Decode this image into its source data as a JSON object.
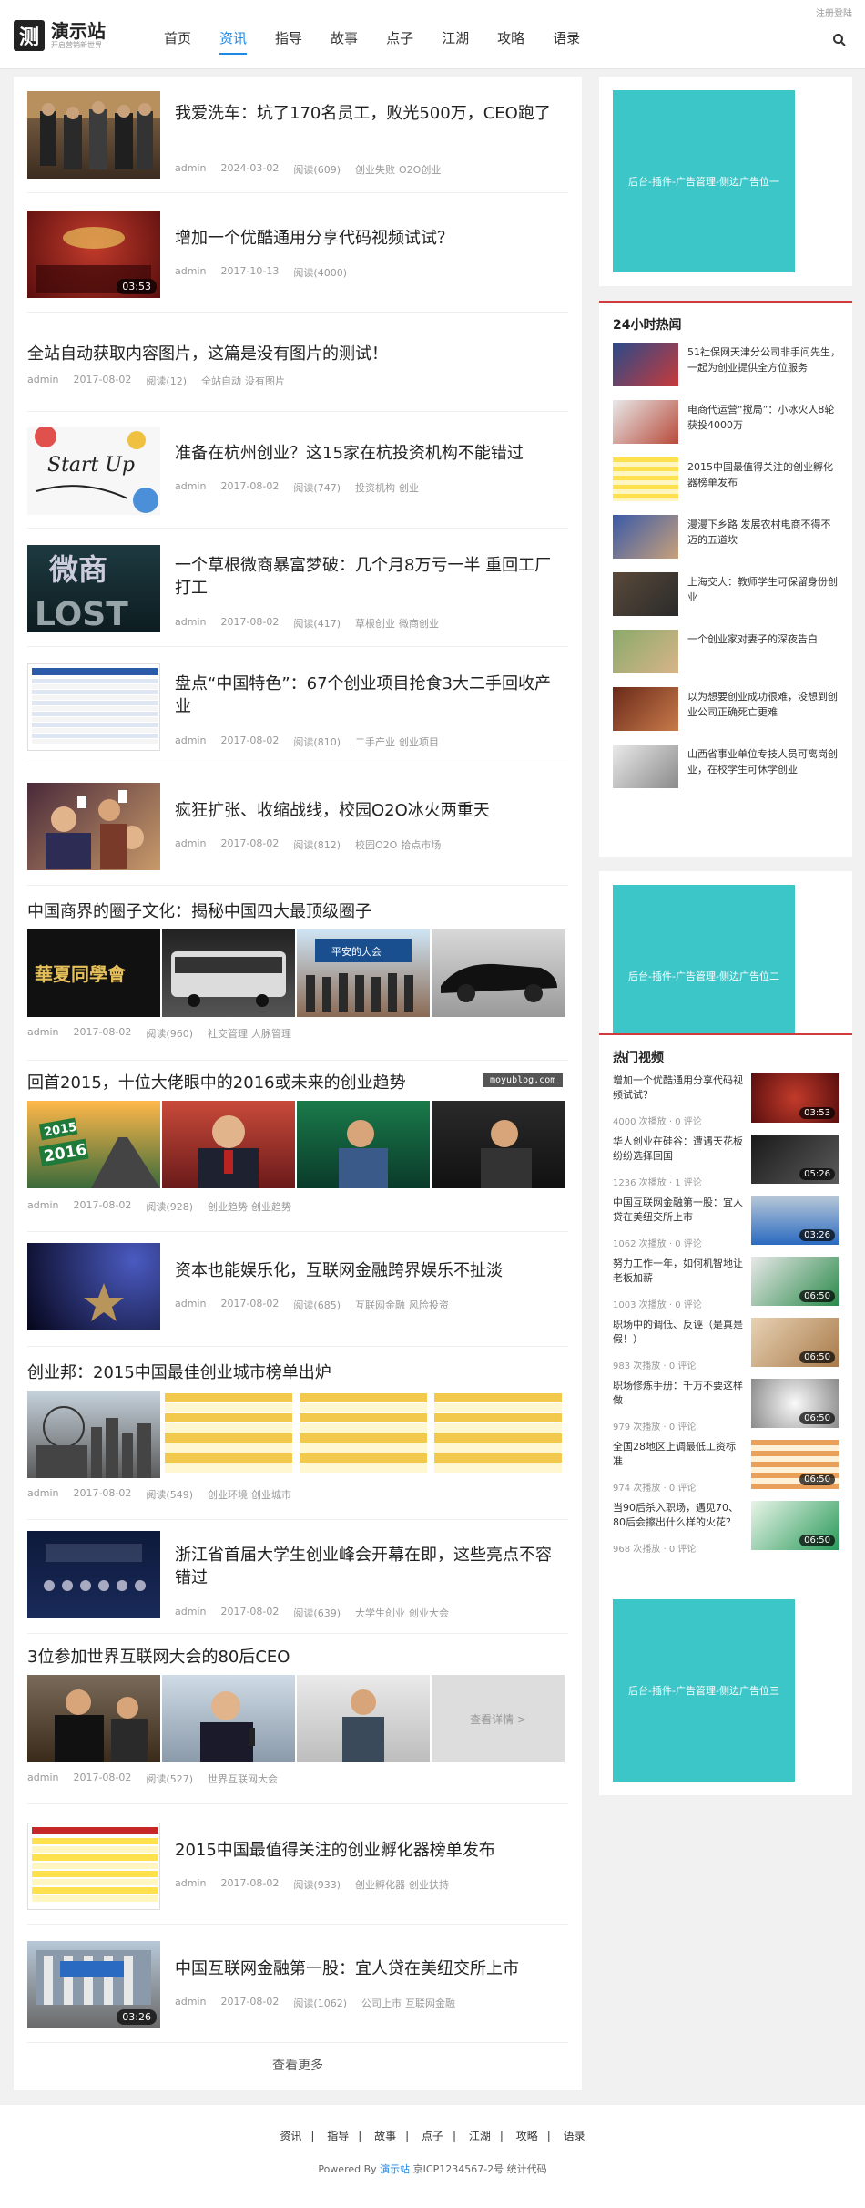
{
  "header": {
    "toplink": "注册登陆",
    "logo_char": "测",
    "logo_name": "演示站",
    "logo_sub": "开启营销新世界",
    "nav": [
      "首页",
      "资讯",
      "指导",
      "故事",
      "点子",
      "江湖",
      "攻略",
      "语录"
    ],
    "active": "资讯"
  },
  "posts": [
    {
      "title": "我爱洗车：坑了170名员工，败光500万，CEO跑了",
      "author": "admin",
      "date": "2024-03-02",
      "views": "阅读(609)",
      "tags": [
        "创业失败",
        "O2O创业"
      ]
    },
    {
      "title": "增加一个优酷通用分享代码视频试试？",
      "author": "admin",
      "date": "2017-10-13",
      "views": "阅读(4000)",
      "tags": [],
      "duration": "03:53"
    },
    {
      "title": "全站自动获取内容图片，这篇是没有图片的测试！",
      "author": "admin",
      "date": "2017-08-02",
      "views": "阅读(12)",
      "tags": [
        "全站自动",
        "没有图片"
      ]
    },
    {
      "title": "准备在杭州创业？这15家在杭投资机构不能错过",
      "author": "admin",
      "date": "2017-08-02",
      "views": "阅读(747)",
      "tags": [
        "投资机构",
        "创业"
      ]
    },
    {
      "title": "一个草根微商暴富梦破：几个月8万亏一半 重回工厂打工",
      "author": "admin",
      "date": "2017-08-02",
      "views": "阅读(417)",
      "tags": [
        "草根创业",
        "微商创业"
      ]
    },
    {
      "title": "盘点“中国特色”：67个创业项目抢食3大二手回收产业",
      "author": "admin",
      "date": "2017-08-02",
      "views": "阅读(810)",
      "tags": [
        "二手产业",
        "创业项目"
      ]
    },
    {
      "title": "疯狂扩张、收缩战线，校园O2O冰火两重天",
      "author": "admin",
      "date": "2017-08-02",
      "views": "阅读(812)",
      "tags": [
        "校园O2O",
        "拾点市场"
      ]
    },
    {
      "title": "中国商界的圈子文化：揭秘中国四大最顶级圈子",
      "author": "admin",
      "date": "2017-08-02",
      "views": "阅读(960)",
      "tags": [
        "社交管理",
        "人脉管理"
      ]
    },
    {
      "title": "回首2015，十位大佬眼中的2016或未来的创业趋势",
      "author": "admin",
      "date": "2017-08-02",
      "views": "阅读(928)",
      "tags": [
        "创业趋势",
        "创业趋势"
      ]
    },
    {
      "title": "资本也能娱乐化，互联网金融跨界娱乐不扯淡",
      "author": "admin",
      "date": "2017-08-02",
      "views": "阅读(685)",
      "tags": [
        "互联网金融",
        "风险投资"
      ]
    },
    {
      "title": "创业邦：2015中国最佳创业城市榜单出炉",
      "author": "admin",
      "date": "2017-08-02",
      "views": "阅读(549)",
      "tags": [
        "创业环境",
        "创业城市"
      ]
    },
    {
      "title": "浙江省首届大学生创业峰会开幕在即，这些亮点不容错过",
      "author": "admin",
      "date": "2017-08-02",
      "views": "阅读(639)",
      "tags": [
        "大学生创业",
        "创业大会"
      ]
    },
    {
      "title": "3位参加世界互联网大会的80后CEO",
      "author": "admin",
      "date": "2017-08-02",
      "views": "阅读(527)",
      "tags": [
        "世界互联网大会"
      ],
      "more_label": "查看详情 >"
    },
    {
      "title": "2015中国最值得关注的创业孵化器榜单发布",
      "author": "admin",
      "date": "2017-08-02",
      "views": "阅读(933)",
      "tags": [
        "创业孵化器",
        "创业扶持"
      ]
    },
    {
      "title": "中国互联网金融第一股：宜人贷在美纽交所上市",
      "author": "admin",
      "date": "2017-08-02",
      "views": "阅读(1062)",
      "tags": [
        "公司上市",
        "互联网金融"
      ],
      "duration": "03:26"
    }
  ],
  "thumb_texts": {
    "startup": "Start Up",
    "weishang": "微商",
    "lost": "LOST",
    "huaxia": "華夏同學會",
    "year2015": "2015",
    "year2016": "2016",
    "party": "平安的大会"
  },
  "watermark": "moyublog.com",
  "load_more": "查看更多",
  "ads": [
    "后台-插件-广告管理-侧边广告位一",
    "后台-插件-广告管理-侧边广告位二",
    "后台-插件-广告管理-侧边广告位三"
  ],
  "hot": {
    "title": "24小时热闻",
    "items": [
      "51社保网天津分公司非手问先生，一起为创业提供全方位服务",
      "电商代运营“搅局”：小冰火人8轮获投4000万",
      "2015中国最值得关注的创业孵化器榜单发布",
      "漫漫下乡路 发展农村电商不得不迈的五道坎",
      "上海交大：教师学生可保留身份创业",
      "一个创业家对妻子的深夜告白",
      "以为想要创业成功很难，没想到创业公司正确死亡更难",
      "山西省事业单位专技人员可离岗创业，在校学生可休学创业"
    ]
  },
  "videos": {
    "title": "热门视频",
    "items": [
      {
        "title": "增加一个优酷通用分享代码视频试试？",
        "plays": "4000 次播放",
        "comments": "0 评论",
        "duration": "03:53"
      },
      {
        "title": "华人创业在硅谷：遭遇天花板 纷纷选择回国",
        "plays": "1236 次播放",
        "comments": "1 评论",
        "duration": "05:26"
      },
      {
        "title": "中国互联网金融第一股：宜人贷在美纽交所上市",
        "plays": "1062 次播放",
        "comments": "0 评论",
        "duration": "03:26"
      },
      {
        "title": "努力工作一年，如何机智地让老板加薪",
        "plays": "1003 次播放",
        "comments": "0 评论",
        "duration": "06:50"
      },
      {
        "title": "职场中的调低、反诬（是真是假！）",
        "plays": "983 次播放",
        "comments": "0 评论",
        "duration": "06:50"
      },
      {
        "title": "职场修炼手册：千万不要这样做",
        "plays": "979 次播放",
        "comments": "0 评论",
        "duration": "06:50"
      },
      {
        "title": "全国28地区上调最低工资标准",
        "plays": "974 次播放",
        "comments": "0 评论",
        "duration": "06:50"
      },
      {
        "title": "当90后杀入职场，遇见70、80后会擦出什么样的火花？",
        "plays": "968 次播放",
        "comments": "0 评论",
        "duration": "06:50"
      }
    ]
  },
  "footer": {
    "nav": [
      "资讯",
      "指导",
      "故事",
      "点子",
      "江湖",
      "攻略",
      "语录"
    ],
    "powered": "Powered By",
    "site": "演示站",
    "icp": "京ICP1234567-2号 统计代码"
  }
}
